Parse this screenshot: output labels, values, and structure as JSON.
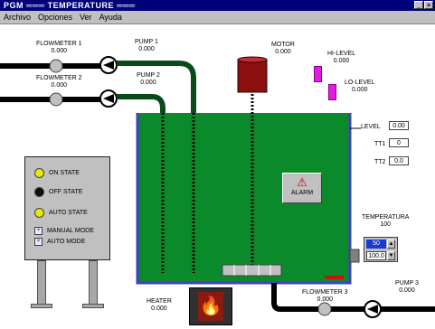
{
  "window": {
    "title": "PGM  ═══ TEMPERATURE ═══"
  },
  "menu": [
    "Archivo",
    "Opciones",
    "Ver",
    "Ayuda"
  ],
  "labels": {
    "flowmeter_1": "FLOWMETER 1",
    "flowmeter_1_value": "0.000",
    "flowmeter_2": "FLOWMETER 2",
    "flowmeter_2_value": "0.000",
    "pump_1": "PUMP 1",
    "pump_1_value": "0.000",
    "pump_2": "PUMP 2",
    "pump_2_value": "0.000",
    "motor": "MOTOR",
    "motor_value": "0.000",
    "hi_level": "HI-LEVEL",
    "hi_level_value": "0.000",
    "lo_level": "LO-LEVEL",
    "lo_level_value": "0.000",
    "level": "LEVEL",
    "tt1": "TT1",
    "tt2": "TT2",
    "temp_setpoint": "TEMPERATURA",
    "temp_setpoint_value": "100",
    "heater": "HEATER",
    "heater_value": "0.000",
    "flowmeter_3": "FLOWMETER 3",
    "flowmeter_3_value": "0.000",
    "pump_3": "PUMP 3",
    "pump_3_value": "0.000",
    "alarm": "ALARM"
  },
  "readouts": {
    "level": "0.00",
    "tt1": "0",
    "tt2": "0.0"
  },
  "spinner": {
    "top": "50",
    "bottom": "100.0"
  },
  "panel": {
    "rows": [
      {
        "label": "ON STATE",
        "lamp": "#e8e800"
      },
      {
        "label": "OFF STATE",
        "lamp": "#101010"
      },
      {
        "label": "AUTO STATE",
        "lamp": "#e8e800"
      }
    ],
    "switches": [
      {
        "label": "MANUAL MODE"
      },
      {
        "label": "AUTO MODE"
      }
    ]
  },
  "colors": {
    "tank_fill": "#0a8a2a",
    "tank_wall": "#4040c0",
    "pipe": "#0a4a1a",
    "motor": "#8a1010",
    "alarm_mark": "#d01010"
  }
}
